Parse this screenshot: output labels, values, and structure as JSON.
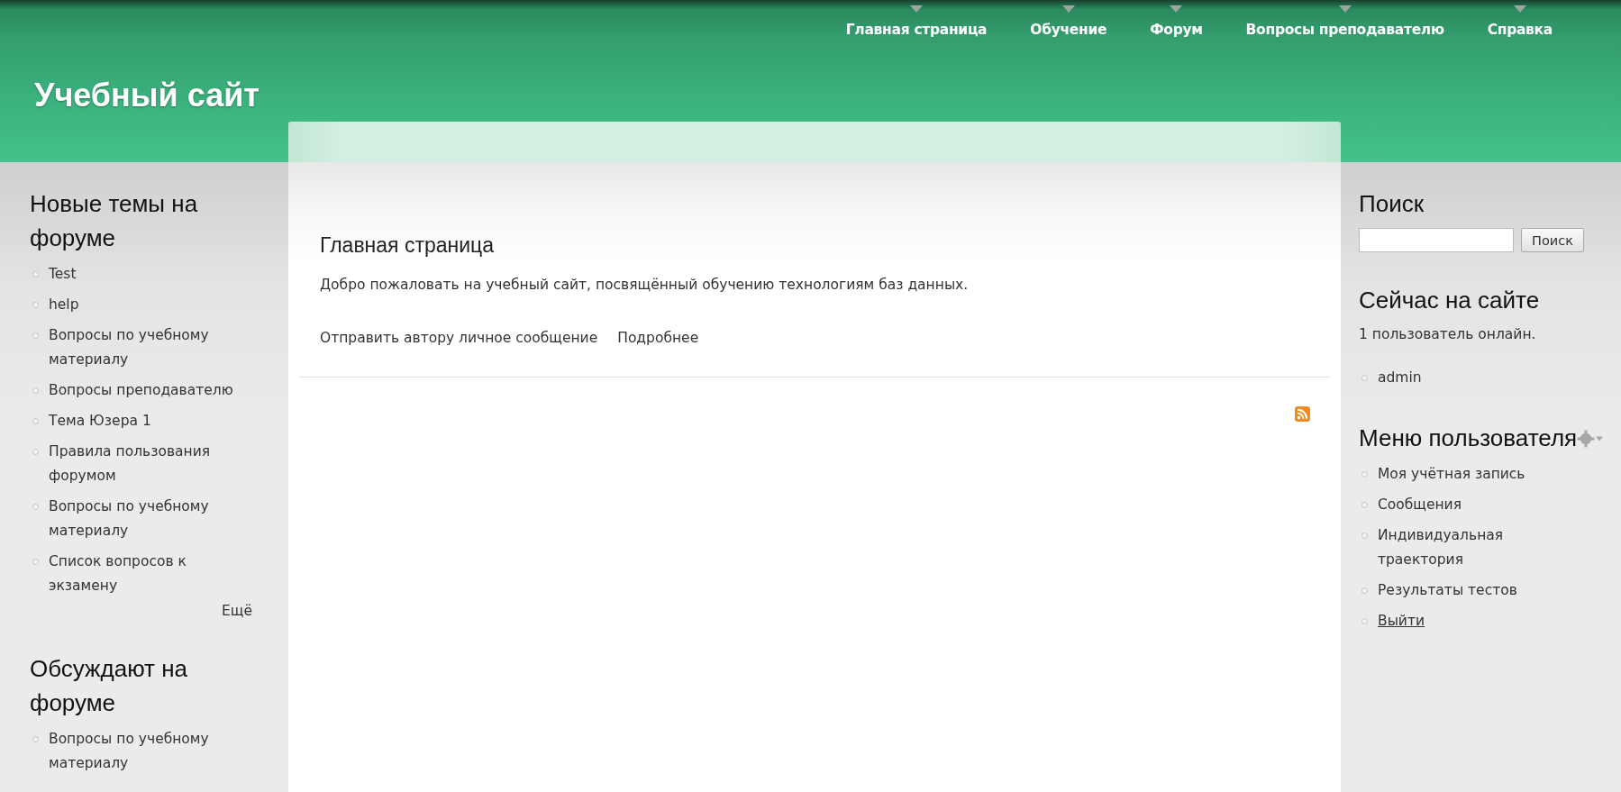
{
  "site_title": "Учебный сайт",
  "nav": [
    {
      "label": "Главная страница"
    },
    {
      "label": "Обучение"
    },
    {
      "label": "Форум"
    },
    {
      "label": "Вопросы преподавателю"
    },
    {
      "label": "Справка"
    }
  ],
  "left_blocks": [
    {
      "title": "Новые темы на форуме",
      "items": [
        "Test",
        "help",
        "Вопросы по учебному материалу",
        "Вопросы преподавателю",
        "Тема Юзера 1",
        "Правила пользования форумом",
        "Вопросы по учебному материалу",
        "Список вопросов к экзамену"
      ],
      "more": "Ещё"
    },
    {
      "title": "Обсуждают на форуме",
      "items": [
        "Вопросы по учебному материалу"
      ]
    }
  ],
  "main": {
    "title": "Главная страница",
    "text": "Добро пожаловать на учебный сайт, посвящённый обучению технологиям баз данных.",
    "links": [
      "Отправить автору личное сообщение",
      "Подробнее"
    ]
  },
  "search": {
    "title": "Поиск",
    "button": "Поиск"
  },
  "online": {
    "title": "Сейчас на сайте",
    "count_text": "1 пользователь онлайн.",
    "users": [
      "admin"
    ]
  },
  "user_menu": {
    "title": "Меню пользователя",
    "items": [
      {
        "label": "Моя учётная запись",
        "underlined": false
      },
      {
        "label": "Сообщения",
        "underlined": false
      },
      {
        "label": "Индивидуальная траектория",
        "underlined": false
      },
      {
        "label": "Результаты тестов",
        "underlined": false
      },
      {
        "label": "Выйти",
        "underlined": true
      }
    ]
  }
}
